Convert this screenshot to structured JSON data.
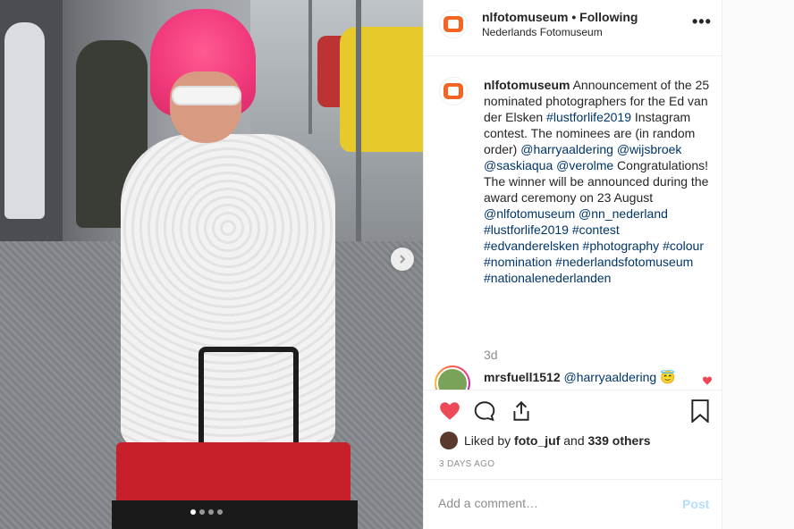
{
  "header": {
    "username": "nlfotomuseum",
    "separator": "•",
    "follow_status": "Following",
    "location": "Nederlands Fotomuseum",
    "more_label": "•••"
  },
  "caption": {
    "username": "nlfotomuseum",
    "lines": [
      {
        "text": "Announcement of the 25 nominated photographers for the Ed van der Elsken ",
        "type": "text"
      },
      {
        "text": "#lustforlife2019",
        "type": "tag"
      },
      {
        "text": " Instagram contest. The nominees are (in random order) ",
        "type": "text"
      },
      {
        "text": "@harryaaldering",
        "type": "tag"
      },
      {
        "text": " ",
        "type": "text"
      },
      {
        "text": "@wijsbroek",
        "type": "tag"
      },
      {
        "text": " ",
        "type": "text"
      },
      {
        "text": "@saskiaqua",
        "type": "tag"
      },
      {
        "text": " ",
        "type": "text"
      },
      {
        "text": "@verolme",
        "type": "tag"
      },
      {
        "text": " Congratulations! The winner will be announced during the award ceremony on 23 August ",
        "type": "text"
      },
      {
        "text": "@nlfotomuseum",
        "type": "tag"
      },
      {
        "text": " ",
        "type": "text"
      },
      {
        "text": "@nn_nederland",
        "type": "tag"
      },
      {
        "text": " ",
        "type": "text"
      },
      {
        "text": "#lustforlife2019",
        "type": "tag"
      },
      {
        "text": " ",
        "type": "text"
      },
      {
        "text": "#contest",
        "type": "tag"
      },
      {
        "text": " ",
        "type": "text"
      },
      {
        "text": "#edvanderelsken",
        "type": "tag"
      },
      {
        "text": " ",
        "type": "text"
      },
      {
        "text": "#photography",
        "type": "tag"
      },
      {
        "text": " ",
        "type": "text"
      },
      {
        "text": "#colour",
        "type": "tag"
      },
      {
        "text": " ",
        "type": "text"
      },
      {
        "text": "#nomination",
        "type": "tag"
      },
      {
        "text": " ",
        "type": "text"
      },
      {
        "text": "#nederlandsfotomuseum",
        "type": "tag"
      },
      {
        "text": " ",
        "type": "text"
      },
      {
        "text": "#nationalenederlanden",
        "type": "tag"
      }
    ],
    "age": "3d"
  },
  "comment": {
    "username": "mrsfuell1512",
    "mention": "@harryaaldering",
    "emoji": "😇"
  },
  "actions": {
    "liked_by_prefix": "Liked by",
    "liked_by_user": "foto_juf",
    "liked_by_and": "and",
    "liked_by_others": "339 others",
    "timestamp": "3 DAYS AGO"
  },
  "add_comment": {
    "placeholder": "Add a comment…",
    "post_label": "Post"
  },
  "carousel": {
    "total": 4,
    "active": 0
  },
  "colors": {
    "heart_active": "#ed4956",
    "tag": "#003569",
    "hair_pink": "#f0387a",
    "cart_red": "#c8202a",
    "post_disabled": "#b2dffc"
  }
}
